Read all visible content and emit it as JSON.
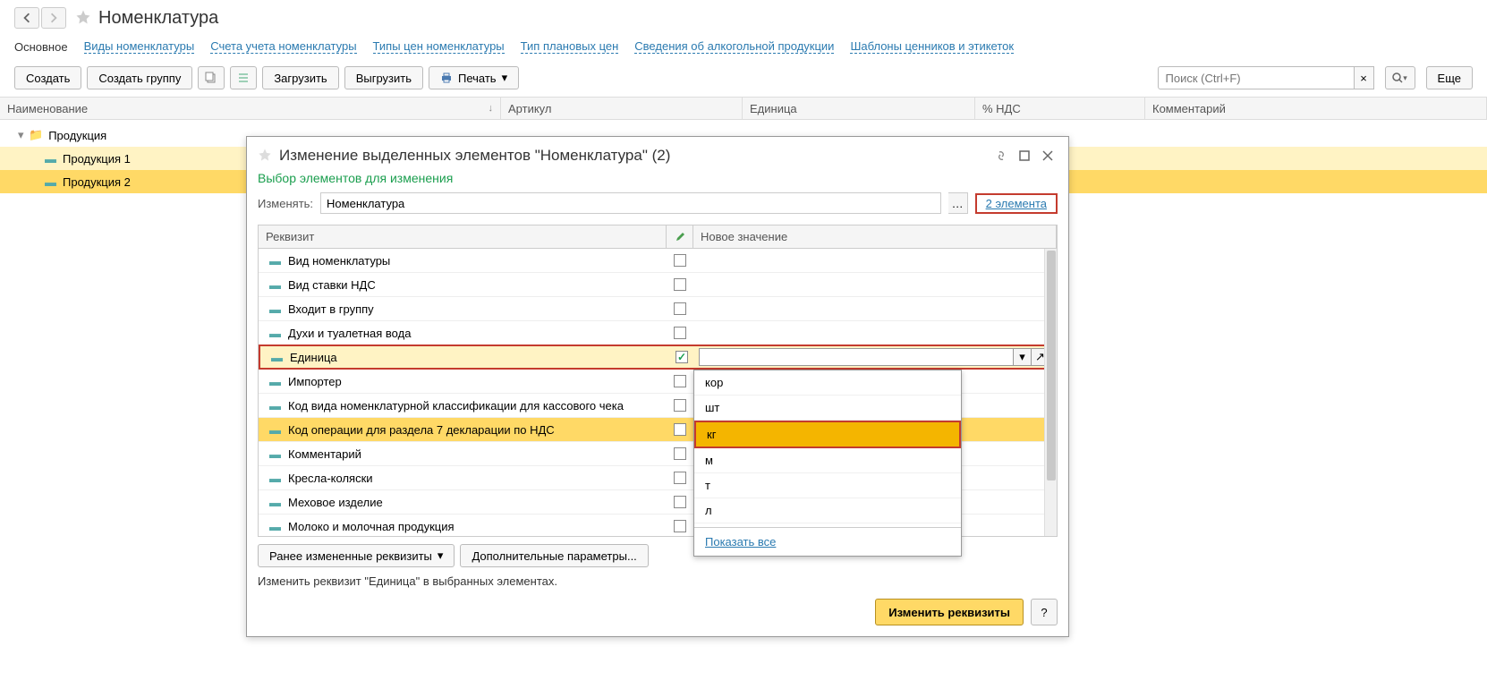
{
  "header": {
    "title": "Номенклатура"
  },
  "nav": {
    "main": "Основное",
    "links": [
      "Виды номенклатуры",
      "Счета учета номенклатуры",
      "Типы цен номенклатуры",
      "Тип плановых цен",
      "Сведения об алкогольной продукции",
      "Шаблоны ценников и этикеток"
    ]
  },
  "toolbar": {
    "create": "Создать",
    "create_group": "Создать группу",
    "load": "Загрузить",
    "export": "Выгрузить",
    "print": "Печать",
    "search_placeholder": "Поиск (Ctrl+F)",
    "more": "Еще"
  },
  "table": {
    "cols": {
      "name": "Наименование",
      "article": "Артикул",
      "unit": "Единица",
      "vat": "% НДС",
      "comment": "Комментарий"
    }
  },
  "tree": {
    "root": "Продукция",
    "items": [
      "Продукция 1",
      "Продукция 2"
    ]
  },
  "dialog": {
    "title": "Изменение выделенных элементов \"Номенклатура\" (2)",
    "subtitle": "Выбор элементов для изменения",
    "change_label": "Изменять:",
    "change_value": "Номенклатура",
    "elements_link": "2 элемента",
    "attr_col": "Реквизит",
    "val_col": "Новое значение",
    "rows": [
      {
        "label": "Вид номенклатуры",
        "checked": false
      },
      {
        "label": "Вид ставки НДС",
        "checked": false
      },
      {
        "label": "Входит в группу",
        "checked": false
      },
      {
        "label": "Духи и туалетная вода",
        "checked": false
      },
      {
        "label": "Единица",
        "checked": true,
        "highlight": true,
        "editing": true
      },
      {
        "label": "Импортер",
        "checked": false
      },
      {
        "label": "Код вида номенклатурной классификации для кассового чека",
        "checked": false
      },
      {
        "label": "Код операции для раздела 7 декларации по НДС",
        "checked": false,
        "sel_row": true
      },
      {
        "label": "Комментарий",
        "checked": false
      },
      {
        "label": "Кресла-коляски",
        "checked": false
      },
      {
        "label": "Меховое изделие",
        "checked": false
      },
      {
        "label": "Молоко и молочная продукция",
        "checked": false
      }
    ],
    "prev_button": "Ранее измененные реквизиты",
    "extra_button": "Дополнительные параметры...",
    "message": "Изменить реквизит \"Единица\" в выбранных элементах.",
    "apply": "Изменить реквизиты",
    "help": "?"
  },
  "dropdown": {
    "items": [
      "кор",
      "шт",
      "кг",
      "м",
      "т",
      "л"
    ],
    "selected_index": 2,
    "show_all": "Показать все"
  }
}
